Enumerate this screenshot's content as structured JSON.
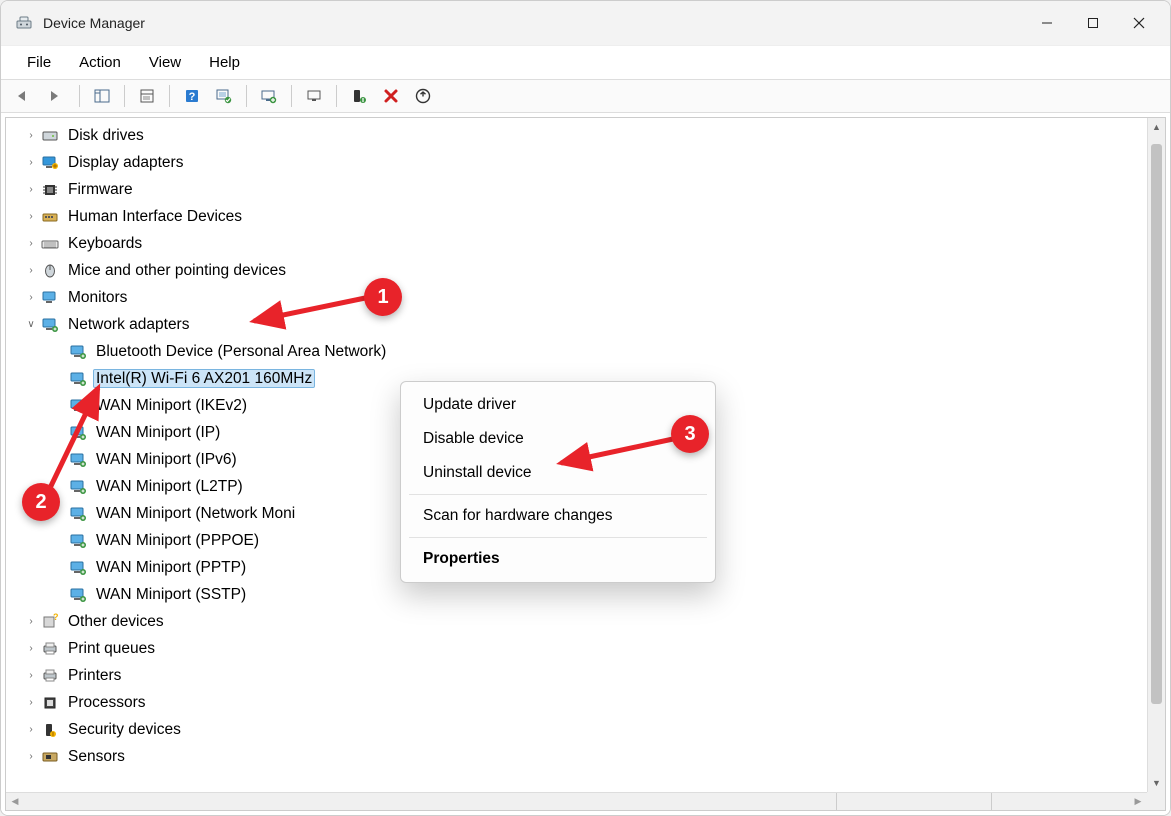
{
  "window": {
    "title": "Device Manager"
  },
  "menubar": [
    "File",
    "Action",
    "View",
    "Help"
  ],
  "tree": {
    "categories": [
      {
        "label": "Disk drives",
        "expanded": false,
        "icon": "disk"
      },
      {
        "label": "Display adapters",
        "expanded": false,
        "icon": "display"
      },
      {
        "label": "Firmware",
        "expanded": false,
        "icon": "chip"
      },
      {
        "label": "Human Interface Devices",
        "expanded": false,
        "icon": "hid"
      },
      {
        "label": "Keyboards",
        "expanded": false,
        "icon": "keyboard"
      },
      {
        "label": "Mice and other pointing devices",
        "expanded": false,
        "icon": "mouse"
      },
      {
        "label": "Monitors",
        "expanded": false,
        "icon": "monitor"
      },
      {
        "label": "Network adapters",
        "expanded": true,
        "icon": "net",
        "children": [
          {
            "label": "Bluetooth Device (Personal Area Network)",
            "icon": "net",
            "selected": false
          },
          {
            "label": "Intel(R) Wi-Fi 6 AX201 160MHz",
            "icon": "net",
            "selected": true
          },
          {
            "label": "WAN Miniport (IKEv2)",
            "icon": "net"
          },
          {
            "label": "WAN Miniport (IP)",
            "icon": "net"
          },
          {
            "label": "WAN Miniport (IPv6)",
            "icon": "net"
          },
          {
            "label": "WAN Miniport (L2TP)",
            "icon": "net"
          },
          {
            "label": "WAN Miniport (Network Moni",
            "icon": "net",
            "truncated": true
          },
          {
            "label": "WAN Miniport (PPPOE)",
            "icon": "net"
          },
          {
            "label": "WAN Miniport (PPTP)",
            "icon": "net"
          },
          {
            "label": "WAN Miniport (SSTP)",
            "icon": "net"
          }
        ]
      },
      {
        "label": "Other devices",
        "expanded": false,
        "icon": "other"
      },
      {
        "label": "Print queues",
        "expanded": false,
        "icon": "printer"
      },
      {
        "label": "Printers",
        "expanded": false,
        "icon": "printer"
      },
      {
        "label": "Processors",
        "expanded": false,
        "icon": "cpu"
      },
      {
        "label": "Security devices",
        "expanded": false,
        "icon": "security"
      },
      {
        "label": "Sensors",
        "expanded": false,
        "icon": "sensor"
      }
    ]
  },
  "context_menu": {
    "items": [
      {
        "label": "Update driver",
        "type": "item"
      },
      {
        "label": "Disable device",
        "type": "item"
      },
      {
        "label": "Uninstall device",
        "type": "item"
      },
      {
        "type": "sep"
      },
      {
        "label": "Scan for hardware changes",
        "type": "item"
      },
      {
        "type": "sep"
      },
      {
        "label": "Properties",
        "type": "item",
        "bold": true
      }
    ]
  },
  "annotations": [
    "1",
    "2",
    "3"
  ]
}
